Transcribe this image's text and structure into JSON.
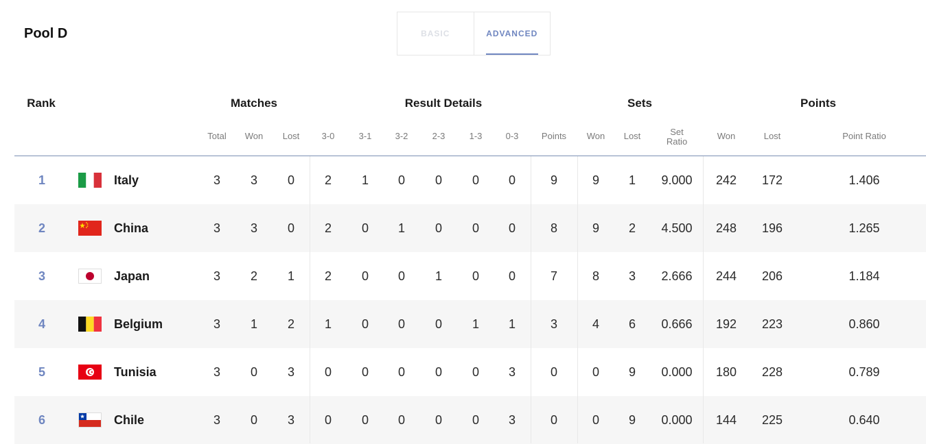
{
  "pool_title": "Pool D",
  "tabs": {
    "basic": "BASIC",
    "advanced": "ADVANCED"
  },
  "groups": {
    "rank": "Rank",
    "matches": "Matches",
    "result_details": "Result Details",
    "sets": "Sets",
    "points": "Points"
  },
  "columns": {
    "total": "Total",
    "won": "Won",
    "lost": "Lost",
    "r30": "3-0",
    "r31": "3-1",
    "r32": "3-2",
    "r23": "2-3",
    "r13": "1-3",
    "r03": "0-3",
    "points": "Points",
    "sets_won": "Won",
    "sets_lost": "Lost",
    "set_ratio_1": "Set",
    "set_ratio_2": "Ratio",
    "pts_won": "Won",
    "pts_lost": "Lost",
    "point_ratio": "Point Ratio"
  },
  "rows": [
    {
      "rank": "1",
      "flag": "italy-flag",
      "country": "Italy",
      "total": "3",
      "won": "3",
      "lost": "0",
      "r30": "2",
      "r31": "1",
      "r32": "0",
      "r23": "0",
      "r13": "0",
      "r03": "0",
      "points": "9",
      "sets_won": "9",
      "sets_lost": "1",
      "set_ratio": "9.000",
      "pts_won": "242",
      "pts_lost": "172",
      "point_ratio": "1.406"
    },
    {
      "rank": "2",
      "flag": "china-flag",
      "country": "China",
      "total": "3",
      "won": "3",
      "lost": "0",
      "r30": "2",
      "r31": "0",
      "r32": "1",
      "r23": "0",
      "r13": "0",
      "r03": "0",
      "points": "8",
      "sets_won": "9",
      "sets_lost": "2",
      "set_ratio": "4.500",
      "pts_won": "248",
      "pts_lost": "196",
      "point_ratio": "1.265"
    },
    {
      "rank": "3",
      "flag": "japan-flag",
      "country": "Japan",
      "total": "3",
      "won": "2",
      "lost": "1",
      "r30": "2",
      "r31": "0",
      "r32": "0",
      "r23": "1",
      "r13": "0",
      "r03": "0",
      "points": "7",
      "sets_won": "8",
      "sets_lost": "3",
      "set_ratio": "2.666",
      "pts_won": "244",
      "pts_lost": "206",
      "point_ratio": "1.184"
    },
    {
      "rank": "4",
      "flag": "belgium-flag",
      "country": "Belgium",
      "total": "3",
      "won": "1",
      "lost": "2",
      "r30": "1",
      "r31": "0",
      "r32": "0",
      "r23": "0",
      "r13": "1",
      "r03": "1",
      "points": "3",
      "sets_won": "4",
      "sets_lost": "6",
      "set_ratio": "0.666",
      "pts_won": "192",
      "pts_lost": "223",
      "point_ratio": "0.860"
    },
    {
      "rank": "5",
      "flag": "tunisia-flag",
      "country": "Tunisia",
      "total": "3",
      "won": "0",
      "lost": "3",
      "r30": "0",
      "r31": "0",
      "r32": "0",
      "r23": "0",
      "r13": "0",
      "r03": "3",
      "points": "0",
      "sets_won": "0",
      "sets_lost": "9",
      "set_ratio": "0.000",
      "pts_won": "180",
      "pts_lost": "228",
      "point_ratio": "0.789"
    },
    {
      "rank": "6",
      "flag": "chile-flag",
      "country": "Chile",
      "total": "3",
      "won": "0",
      "lost": "3",
      "r30": "0",
      "r31": "0",
      "r32": "0",
      "r23": "0",
      "r13": "0",
      "r03": "3",
      "points": "0",
      "sets_won": "0",
      "sets_lost": "9",
      "set_ratio": "0.000",
      "pts_won": "144",
      "pts_lost": "225",
      "point_ratio": "0.640"
    }
  ],
  "colors": {
    "accent": "#6f86c0",
    "shade": "#f6f6f6",
    "header_line": "#7b8fb3"
  }
}
